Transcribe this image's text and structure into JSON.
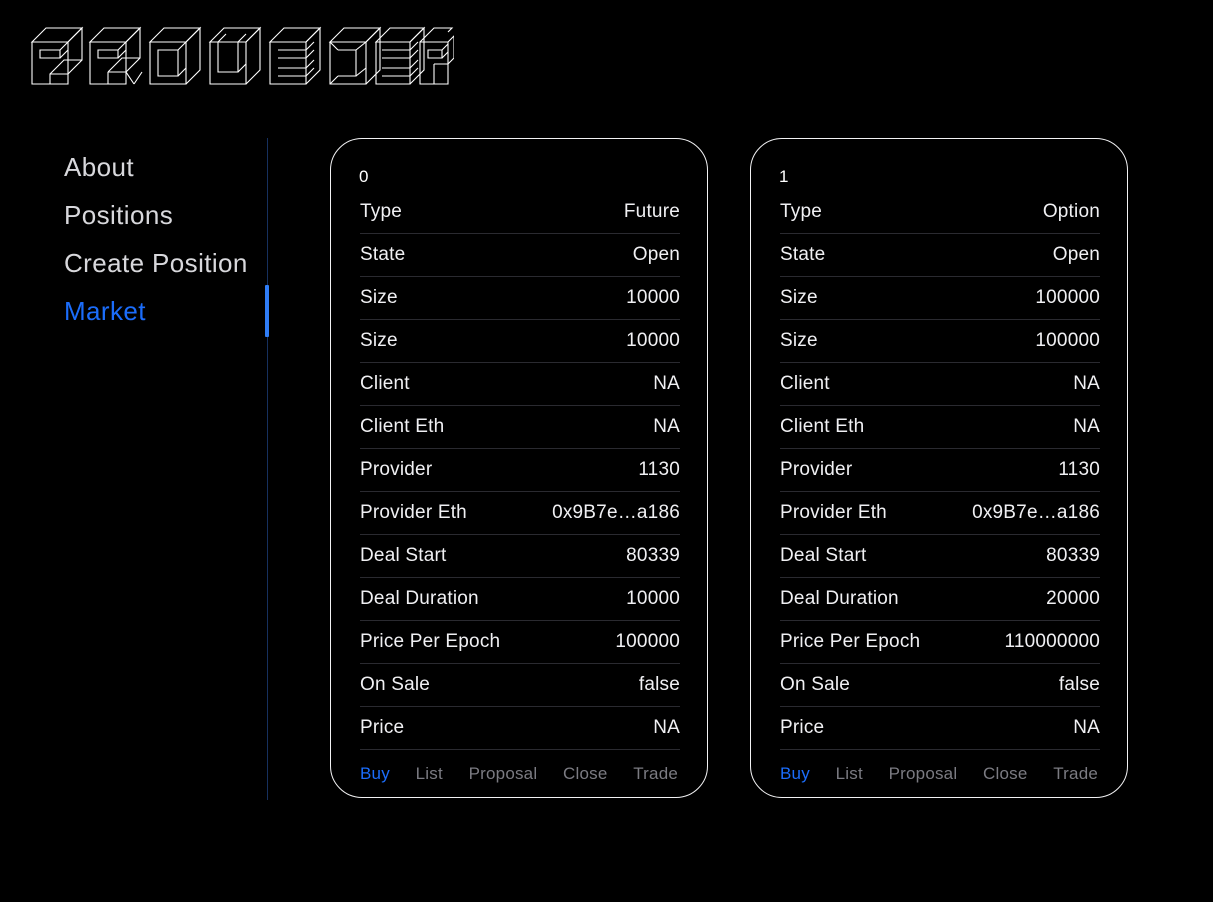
{
  "brand": {
    "logo_text": "PROVIDER",
    "logo_style": "3d-isometric-wireframe"
  },
  "sidebar": {
    "items": [
      {
        "label": "About",
        "active": false
      },
      {
        "label": "Positions",
        "active": false
      },
      {
        "label": "Create Position",
        "active": false
      },
      {
        "label": "Market",
        "active": true
      }
    ],
    "active_index": 3,
    "rail_color": "#16305e",
    "active_marker_color": "#2f7df6"
  },
  "theme": {
    "background": "#000000",
    "text": "#f0f0f3",
    "muted_text": "#7b7b82",
    "accent": "#1b6dfb",
    "card_border": "#f2f2f4",
    "row_divider": "#2a2a30"
  },
  "cards": [
    {
      "index": "0",
      "rows": [
        {
          "label": "Type",
          "value": "Future"
        },
        {
          "label": "State",
          "value": "Open"
        },
        {
          "label": "Size",
          "value": "10000"
        },
        {
          "label": "Size",
          "value": "10000"
        },
        {
          "label": "Client",
          "value": "NA"
        },
        {
          "label": "Client Eth",
          "value": "NA"
        },
        {
          "label": "Provider",
          "value": "1130"
        },
        {
          "label": "Provider Eth",
          "value": "0x9B7e…a186"
        },
        {
          "label": "Deal Start",
          "value": "80339"
        },
        {
          "label": "Deal Duration",
          "value": "10000"
        },
        {
          "label": "Price Per Epoch",
          "value": "100000"
        },
        {
          "label": "On Sale",
          "value": "false"
        },
        {
          "label": "Price",
          "value": "NA"
        }
      ],
      "actions": [
        {
          "label": "Buy",
          "primary": true
        },
        {
          "label": "List",
          "primary": false
        },
        {
          "label": "Proposal",
          "primary": false
        },
        {
          "label": "Close",
          "primary": false
        },
        {
          "label": "Trade",
          "primary": false
        }
      ]
    },
    {
      "index": "1",
      "rows": [
        {
          "label": "Type",
          "value": "Option"
        },
        {
          "label": "State",
          "value": "Open"
        },
        {
          "label": "Size",
          "value": "100000"
        },
        {
          "label": "Size",
          "value": "100000"
        },
        {
          "label": "Client",
          "value": "NA"
        },
        {
          "label": "Client Eth",
          "value": "NA"
        },
        {
          "label": "Provider",
          "value": "1130"
        },
        {
          "label": "Provider Eth",
          "value": "0x9B7e…a186"
        },
        {
          "label": "Deal Start",
          "value": "80339"
        },
        {
          "label": "Deal Duration",
          "value": "20000"
        },
        {
          "label": "Price Per Epoch",
          "value": "110000000"
        },
        {
          "label": "On Sale",
          "value": "false"
        },
        {
          "label": "Price",
          "value": "NA"
        }
      ],
      "actions": [
        {
          "label": "Buy",
          "primary": true
        },
        {
          "label": "List",
          "primary": false
        },
        {
          "label": "Proposal",
          "primary": false
        },
        {
          "label": "Close",
          "primary": false
        },
        {
          "label": "Trade",
          "primary": false
        }
      ]
    }
  ]
}
